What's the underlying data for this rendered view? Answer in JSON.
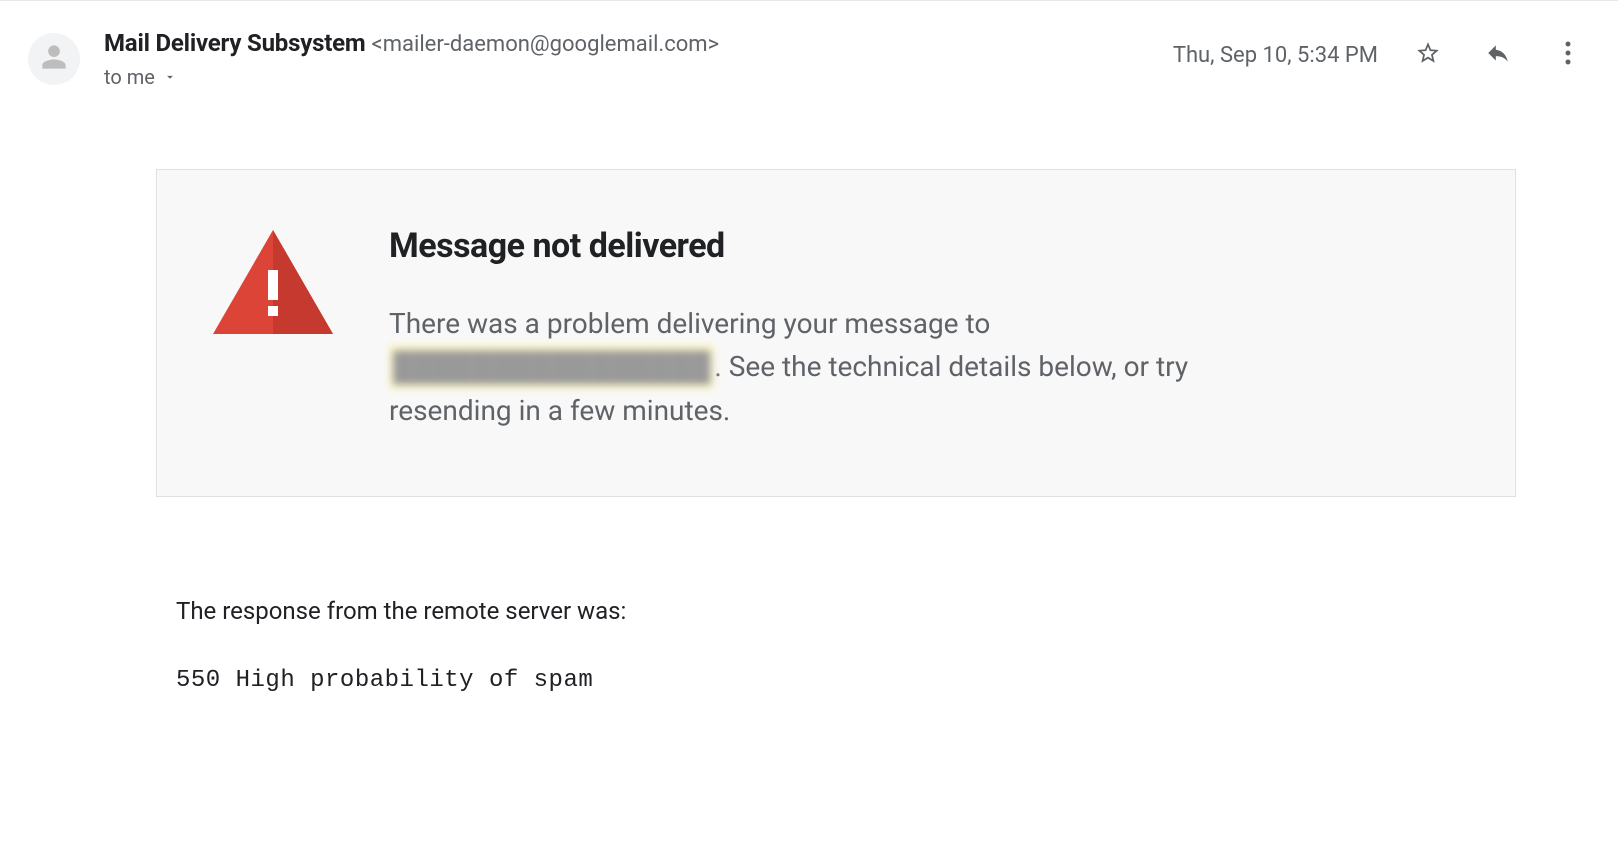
{
  "header": {
    "sender_name": "Mail Delivery Subsystem",
    "sender_email": "<mailer-daemon@googlemail.com>",
    "recipient_line": "to me",
    "timestamp": "Thu, Sep 10, 5:34 PM"
  },
  "notice": {
    "title": "Message not delivered",
    "desc_before": "There was a problem delivering your message to ",
    "redacted_placeholder": "████████████████",
    "desc_after": ". See the technical details below, or try resending in a few minutes."
  },
  "response": {
    "label": "The response from the remote server was:",
    "code": "550 High probability of spam"
  }
}
